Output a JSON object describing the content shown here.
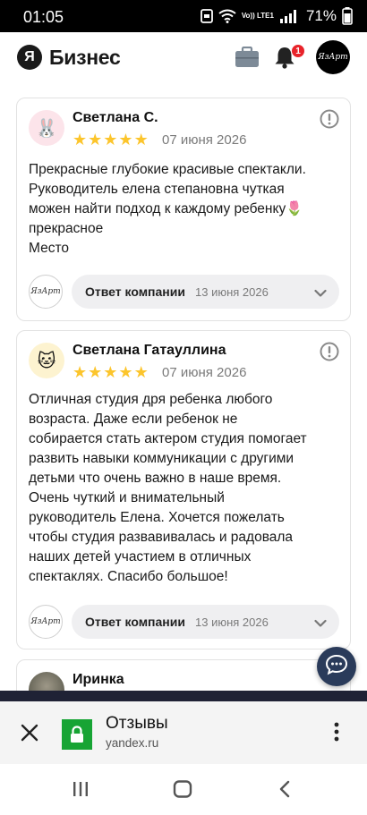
{
  "status_bar": {
    "time": "01:05",
    "network": "Vo)) LTE1",
    "battery": "71%",
    "icons": [
      "silent-icon",
      "wifi-icon",
      "signal-icon",
      "battery-icon"
    ]
  },
  "header": {
    "logo_letter": "Я",
    "logo_text": "Бизнес",
    "notification_count": "1",
    "profile_mark": "ЯзАрт",
    "icons": [
      "briefcase-icon",
      "bell-icon"
    ]
  },
  "reviews": [
    {
      "name": "Светлана С.",
      "avatar_emoji": "🐰",
      "rating": 5,
      "date": "07 июня 2026",
      "text_lines": [
        "Прекрасные глубокие красивые спектакли.",
        "Руководитель елена степановна чуткая",
        "можен найти подход к каждому ребенку🌷",
        "прекрасное",
        "Место"
      ],
      "reply_label": "Ответ компании",
      "reply_date": "13 июня 2026"
    },
    {
      "name": "Светлана Гатауллина",
      "avatar_emoji": "🐱",
      "rating": 5,
      "date": "07 июня 2026",
      "text_lines": [
        "Отличная студия дря ребенка любого",
        "возраста. Даже если ребенок не",
        "собирается стать актером студия помогает",
        "развить навыки коммуникации с другими",
        "детьми что очень важно в наше время.",
        "Очень чуткий и внимательный",
        "руководитель Елена. Хочется пожелать",
        "чтобы студия развавивалась и радовала",
        "наших детей участием в отличных",
        "спектаклях. Спасибо большое!"
      ],
      "reply_label": "Ответ компании",
      "reply_date": "13 июня 2026"
    },
    {
      "name": "Иринка"
    }
  ],
  "company_logo_mark": "ЯзАрт",
  "bottom_sheet": {
    "title": "Отзывы",
    "url": "yandex.ru"
  },
  "colors": {
    "star": "#fcc52c",
    "badge": "#e8232a",
    "lock_green": "#17a434",
    "chat_fab": "#2a3b5a"
  }
}
